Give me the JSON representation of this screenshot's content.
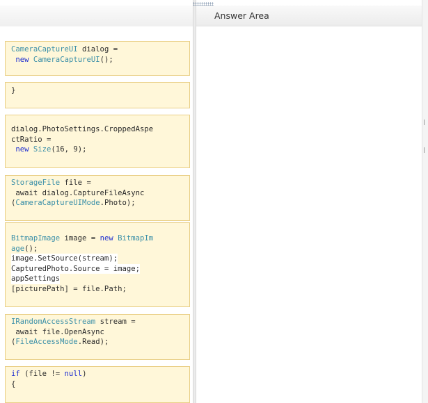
{
  "answer_area": {
    "title": "Answer Area"
  },
  "code_blocks": [
    {
      "id": "camera-dialog",
      "lines": [
        [
          {
            "t": "CameraCaptureUI",
            "c": "type"
          },
          {
            "t": " dialog =",
            "c": "plain"
          }
        ],
        [
          {
            "t": " ",
            "c": "plain"
          },
          {
            "t": "new",
            "c": "keyword"
          },
          {
            "t": " ",
            "c": "plain"
          },
          {
            "t": "CameraCaptureUI",
            "c": "type"
          },
          {
            "t": "();",
            "c": "plain"
          }
        ]
      ]
    },
    {
      "id": "closing-brace",
      "lines": [
        [
          {
            "t": "}",
            "c": "plain"
          }
        ]
      ]
    },
    {
      "id": "cropped-aspect-ratio",
      "lines": [
        [
          {
            "t": "dialog.PhotoSettings.CroppedAspe",
            "c": "plain"
          }
        ],
        [
          {
            "t": "ctRatio =",
            "c": "plain"
          }
        ],
        [
          {
            "t": " ",
            "c": "plain"
          },
          {
            "t": "new",
            "c": "keyword"
          },
          {
            "t": " ",
            "c": "plain"
          },
          {
            "t": "Size",
            "c": "type"
          },
          {
            "t": "(16, 9);",
            "c": "plain"
          }
        ]
      ]
    },
    {
      "id": "capture-file",
      "lines": [
        [
          {
            "t": "StorageFile",
            "c": "type"
          },
          {
            "t": " file =",
            "c": "plain"
          }
        ],
        [
          {
            "t": " await dialog.CaptureFileAsync",
            "c": "plain"
          }
        ],
        [
          {
            "t": "(",
            "c": "plain"
          },
          {
            "t": "CameraCaptureUIMode",
            "c": "type"
          },
          {
            "t": ".Photo);",
            "c": "plain"
          }
        ]
      ]
    },
    {
      "id": "bitmap-image",
      "lines": [
        [
          {
            "t": "BitmapImage",
            "c": "type"
          },
          {
            "t": " image = ",
            "c": "plain"
          },
          {
            "t": "new",
            "c": "keyword"
          },
          {
            "t": " ",
            "c": "plain"
          },
          {
            "t": "BitmapIm",
            "c": "type"
          }
        ],
        [
          {
            "t": "age",
            "c": "type"
          },
          {
            "t": "();",
            "c": "plain"
          }
        ],
        [
          {
            "t": "image.SetSource(stream);",
            "c": "highlight"
          }
        ],
        [
          {
            "t": "CapturedPhoto.Source = image;",
            "c": "highlight"
          }
        ],
        [
          {
            "t": "appSettings",
            "c": "highlight"
          }
        ],
        [
          {
            "t": "[picturePath] = file.Path;",
            "c": "plain"
          }
        ]
      ]
    },
    {
      "id": "open-stream",
      "lines": [
        [
          {
            "t": "IRandomAccessStream",
            "c": "type"
          },
          {
            "t": " stream =",
            "c": "plain"
          }
        ],
        [
          {
            "t": " await file.OpenAsync",
            "c": "plain"
          }
        ],
        [
          {
            "t": "(",
            "c": "plain"
          },
          {
            "t": "FileAccessMode",
            "c": "type"
          },
          {
            "t": ".Read);",
            "c": "plain"
          }
        ]
      ]
    },
    {
      "id": "if-file-not-null",
      "lines": [
        [
          {
            "t": "if",
            "c": "keyword"
          },
          {
            "t": " (file != ",
            "c": "plain"
          },
          {
            "t": "null",
            "c": "keyword"
          },
          {
            "t": ")",
            "c": "plain"
          }
        ],
        [
          {
            "t": "{",
            "c": "plain"
          }
        ]
      ]
    }
  ]
}
